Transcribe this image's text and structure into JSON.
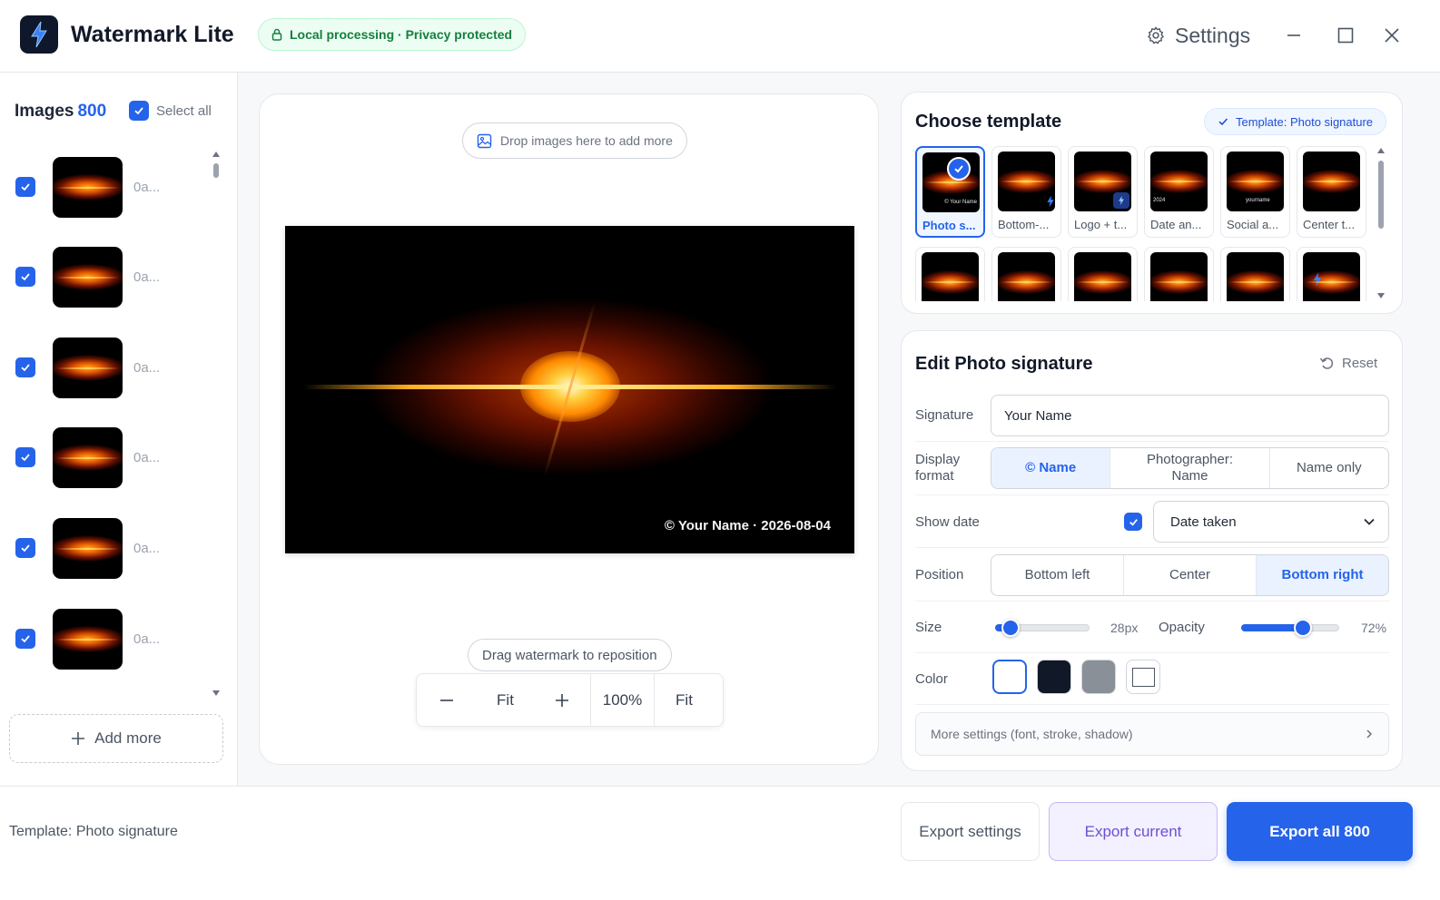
{
  "app": {
    "title": "Watermark Lite",
    "privacy_badge": "Local processing · Privacy protected",
    "settings_label": "Settings",
    "accent_color": "#2563eb"
  },
  "sidebar": {
    "images_label": "Images",
    "images_count": "800",
    "select_all_label": "Select all",
    "select_all_checked": true,
    "items": [
      {
        "name": "0a...",
        "checked": true
      },
      {
        "name": "0a...",
        "checked": true
      },
      {
        "name": "0a...",
        "checked": true
      },
      {
        "name": "0a...",
        "checked": true
      },
      {
        "name": "0a...",
        "checked": true
      },
      {
        "name": "0a...",
        "checked": true
      }
    ],
    "add_more_label": "Add more"
  },
  "canvas": {
    "drop_hint": "Drop images here to add more",
    "watermark_text": "© Your Name · 2026-08-04",
    "drag_hint": "Drag watermark to reposition",
    "zoom": {
      "minus_icon": "minus-icon",
      "fit_label": "Fit",
      "plus_icon": "plus-icon",
      "zoom_value": "100%",
      "fit_label_2": "Fit"
    }
  },
  "templates": {
    "title": "Choose template",
    "current_badge": "Template: Photo signature",
    "items": [
      {
        "name": "Photo s...",
        "selected": true,
        "overlay": "© Your Name"
      },
      {
        "name": "Bottom-...",
        "selected": false,
        "overlay": ""
      },
      {
        "name": "Logo + t...",
        "selected": false,
        "overlay": ""
      },
      {
        "name": "Date an...",
        "selected": false,
        "overlay": "2024"
      },
      {
        "name": "Social a...",
        "selected": false,
        "overlay": "yourname"
      },
      {
        "name": "Center t...",
        "selected": false,
        "overlay": ""
      },
      {
        "name": "",
        "selected": false,
        "overlay": ""
      },
      {
        "name": "",
        "selected": false,
        "overlay": ""
      },
      {
        "name": "",
        "selected": false,
        "overlay": ""
      },
      {
        "name": "",
        "selected": false,
        "overlay": ""
      },
      {
        "name": "",
        "selected": false,
        "overlay": ""
      },
      {
        "name": "",
        "selected": false,
        "overlay": ""
      }
    ]
  },
  "editor": {
    "title": "Edit Photo signature",
    "reset_label": "Reset",
    "signature_label": "Signature",
    "signature_value": "Your Name",
    "display_format_label": "Display format",
    "display_format_options": [
      "© Name",
      "Photographer: Name",
      "Name only"
    ],
    "display_format_selected": "© Name",
    "show_date_label": "Show date",
    "show_date_checked": true,
    "date_source": "Date taken",
    "position_label": "Position",
    "position_options": [
      "Bottom left",
      "Center",
      "Bottom right"
    ],
    "position_selected": "Bottom right",
    "size_label": "Size",
    "size_value": "28px",
    "size_fraction": 0.16,
    "opacity_label": "Opacity",
    "opacity_value": "72%",
    "opacity_fraction": 0.63,
    "color_label": "Color",
    "colors": [
      "#ffffff",
      "#111827",
      "#8a9098",
      "#ffffff"
    ],
    "color_selected": 0,
    "more_settings_label": "More settings (font, stroke, shadow)"
  },
  "footer": {
    "template_status": "Template: Photo signature",
    "export_settings_label": "Export settings",
    "export_current_label": "Export current",
    "export_all_label": "Export all 800"
  }
}
